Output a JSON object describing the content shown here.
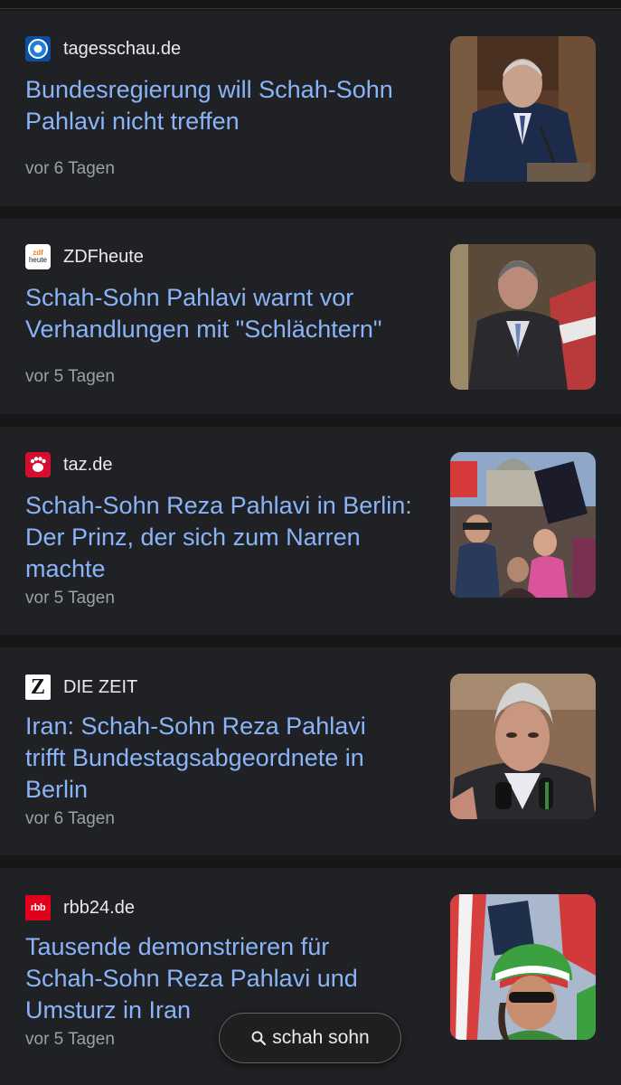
{
  "articles": [
    {
      "source": "tagesschau.de",
      "source_icon": "tagesschau-logo-icon",
      "title_line1": "Bundesregierung will Schah-Sohn",
      "title_line2": "Pahlavi nicht treffen",
      "title_line3": "",
      "age": "vor 6 Tagen",
      "thumb": "man-at-podium-image"
    },
    {
      "source": "ZDFheute",
      "source_icon": "zdfheute-logo-icon",
      "logo_text_1": "zdf",
      "logo_text_2": "heute",
      "title_line1": "Schah-Sohn Pahlavi warnt vor",
      "title_line2": "Verhandlungen mit \"Schlächtern\"",
      "title_line3": "",
      "age": "vor 5 Tagen",
      "thumb": "man-with-flag-image"
    },
    {
      "source": "taz.de",
      "source_icon": "taz-paw-logo-icon",
      "title_line1": "Schah-Sohn Reza Pahlavi in Berlin:",
      "title_line2": "Der Prinz, der sich zum Narren",
      "title_line3": "machte",
      "age": "vor 5 Tagen",
      "thumb": "crowd-reichstag-image"
    },
    {
      "source": "DIE ZEIT",
      "source_icon": "zeit-z-logo-icon",
      "logo_text": "Z",
      "title_line1": "Iran: Schah-Sohn Reza Pahlavi",
      "title_line2": "trifft Bundestagsabgeordnete in",
      "title_line3": "Berlin",
      "age": "vor 6 Tagen",
      "thumb": "man-with-microphones-image"
    },
    {
      "source": "rbb24.de",
      "source_icon": "rbb-logo-icon",
      "logo_text": "rbb",
      "title_line1": "Tausende demonstrieren für",
      "title_line2": "Schah-Sohn Reza Pahlavi und",
      "title_line3": "Umsturz in Iran",
      "age": "vor 5 Tagen",
      "thumb": "demonstrator-flag-hat-image"
    }
  ],
  "search_pill": {
    "icon": "search-icon",
    "label": "schah sohn"
  },
  "colors": {
    "background": "#171717",
    "card": "#202124",
    "title": "#8ab4f8",
    "source": "#e8eaed",
    "age": "#9aa0a6"
  }
}
